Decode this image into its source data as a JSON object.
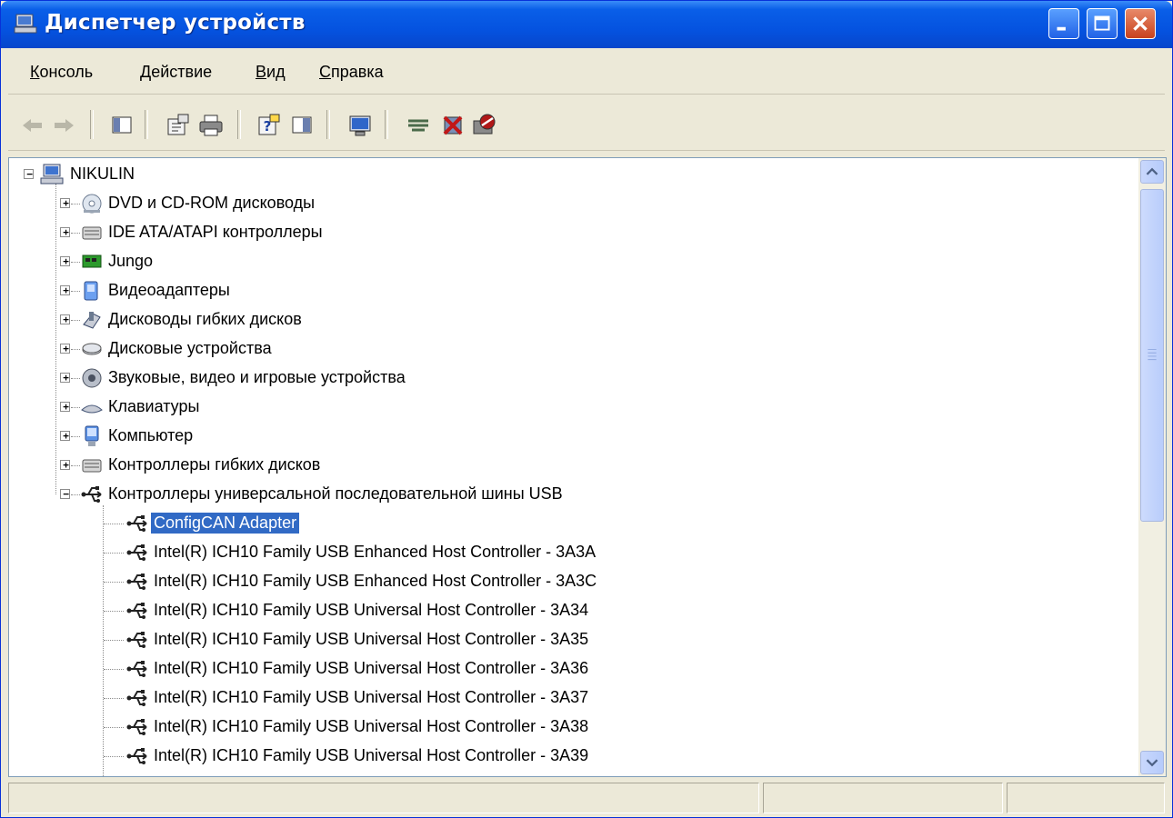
{
  "window": {
    "title": "Диспетчер устройств"
  },
  "menu": [
    {
      "pre": "",
      "u": "К",
      "post": "онсоль"
    },
    {
      "pre": "",
      "u": "Д",
      "post": "ействие"
    },
    {
      "pre": "",
      "u": "В",
      "post": "ид"
    },
    {
      "pre": "",
      "u": "С",
      "post": "правка"
    }
  ],
  "toolbar": [
    "back-icon",
    "forward-icon",
    "show-hide-tree-icon",
    "properties-icon",
    "print-icon",
    "help-icon",
    "action-pane-icon",
    "scan-hardware-icon",
    "update-driver-icon",
    "uninstall-icon",
    "disable-icon"
  ],
  "tree": {
    "root": "NIKULIN",
    "categories": [
      {
        "label": "DVD и CD-ROM дисководы",
        "icon": "cdrom-icon"
      },
      {
        "label": "IDE ATA/ATAPI контроллеры",
        "icon": "ide-controller-icon"
      },
      {
        "label": "Jungo",
        "icon": "jungo-board-icon"
      },
      {
        "label": "Видеоадаптеры",
        "icon": "display-adapter-icon"
      },
      {
        "label": "Дисководы гибких дисков",
        "icon": "floppy-drive-icon"
      },
      {
        "label": "Дисковые устройства",
        "icon": "disk-drive-icon"
      },
      {
        "label": "Звуковые, видео и игровые устройства",
        "icon": "sound-device-icon"
      },
      {
        "label": "Клавиатуры",
        "icon": "keyboard-icon"
      },
      {
        "label": "Компьютер",
        "icon": "computer-icon"
      },
      {
        "label": "Контроллеры гибких дисков",
        "icon": "floppy-controller-icon"
      },
      {
        "label": "Контроллеры универсальной последовательной шины USB",
        "icon": "usb-icon"
      }
    ],
    "usb_devices": [
      "ConfigCAN Adapter",
      "Intel(R) ICH10 Family USB Enhanced Host Controller - 3A3A",
      "Intel(R) ICH10 Family USB Enhanced Host Controller - 3A3C",
      "Intel(R) ICH10 Family USB Universal Host Controller - 3A34",
      "Intel(R) ICH10 Family USB Universal Host Controller - 3A35",
      "Intel(R) ICH10 Family USB Universal Host Controller - 3A36",
      "Intel(R) ICH10 Family USB Universal Host Controller - 3A37",
      "Intel(R) ICH10 Family USB Universal Host Controller - 3A38",
      "Intel(R) ICH10 Family USB Universal Host Controller - 3A39"
    ],
    "selected": "ConfigCAN Adapter",
    "expand_plus": "+",
    "expand_minus": "−"
  },
  "colors": {
    "title_bar": "#0553E0",
    "selection": "#316AC5",
    "chrome": "#ECE9D8"
  }
}
